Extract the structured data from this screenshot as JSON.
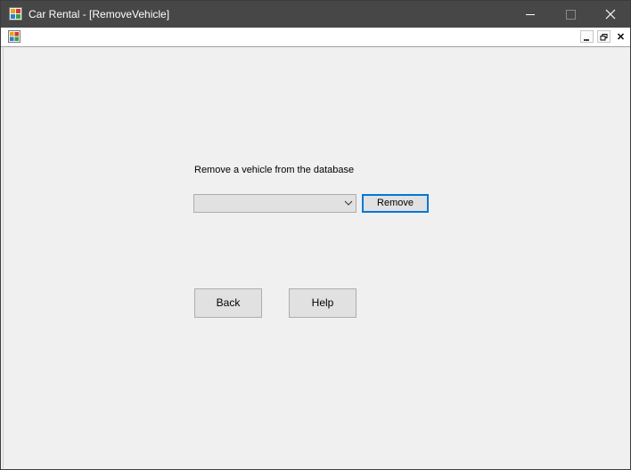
{
  "window": {
    "title": "Car Rental - [RemoveVehicle]"
  },
  "titlebar": {
    "icons": [
      "app-icon",
      "minimize-icon",
      "maximize-icon",
      "close-icon"
    ]
  },
  "mdi": {
    "icons": [
      "child-form-icon",
      "mdi-minimize-icon",
      "mdi-restore-icon",
      "mdi-close-icon"
    ]
  },
  "form": {
    "heading": "Remove a vehicle from the database",
    "vehicle_select_value": "",
    "remove_label": "Remove",
    "back_label": "Back",
    "help_label": "Help"
  },
  "colors": {
    "titlebar": "#474747",
    "background": "#f0f0f0",
    "focus_border": "#0078d7"
  }
}
